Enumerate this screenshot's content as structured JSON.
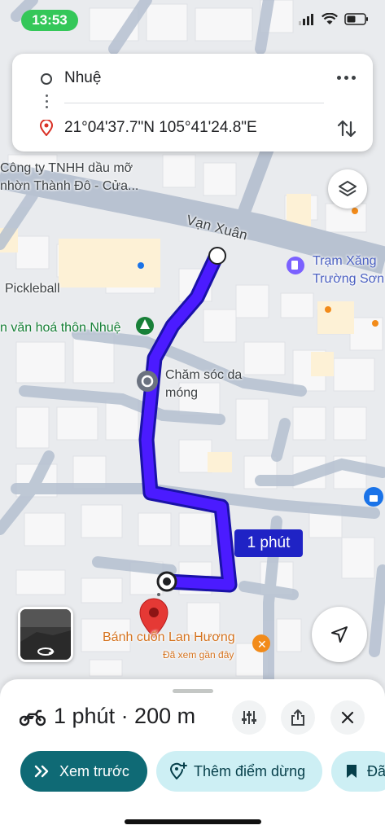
{
  "status_bar": {
    "time": "13:53"
  },
  "directions": {
    "origin": "Nhuệ",
    "destination": "21°04'37.7\"N 105°41'24.8\"E",
    "more_icon": "more-horizontal-icon",
    "swap_icon": "swap-vertical-icon"
  },
  "map": {
    "labels": {
      "company_line1": "Công ty TNHH dầu mỡ",
      "company_line2": "nhờn Thành Đô - Cửa...",
      "road": "Vạn Xuân",
      "gas_line1": "Trạm Xăng",
      "gas_line2": "Trường Sơn",
      "pickleball": "Pickleball",
      "culture_house": "n văn hoá thôn Nhuệ",
      "nail_line1": "Chăm sóc da",
      "nail_line2": "móng",
      "bakery": "Bánh cuốn Lan Hương",
      "bakery_sub": "Đã xem gần đây"
    },
    "route_duration_badge": "1 phút",
    "route_color": "#4b1bff"
  },
  "bottom_sheet": {
    "summary": "1 phút · 200 m",
    "mode_icon": "motorbike-icon",
    "buttons": {
      "preview": "Xem trước",
      "add_stop": "Thêm điểm dừng",
      "save": "Đã"
    }
  }
}
